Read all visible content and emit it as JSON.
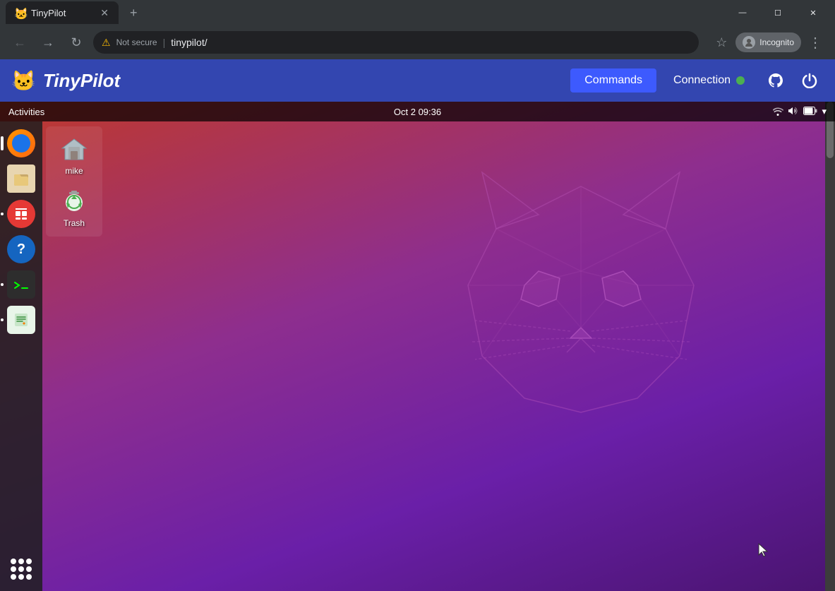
{
  "browser": {
    "tab": {
      "title": "TinyPilot",
      "favicon": "🐱"
    },
    "address": {
      "security_label": "Not secure",
      "url": "tinypilot/",
      "incognito_label": "Incognito"
    },
    "window_controls": {
      "minimize": "—",
      "maximize": "☐",
      "close": "✕"
    }
  },
  "tinypilot": {
    "logo_emoji": "🐱",
    "logo_text": "TinyPilot",
    "commands_label": "Commands",
    "connection_label": "Connection",
    "github_icon": "github",
    "power_icon": "power"
  },
  "ubuntu": {
    "topbar": {
      "activities": "Activities",
      "clock": "Oct 2  09:36",
      "wifi_icon": "wifi",
      "sound_icon": "sound",
      "battery_icon": "battery",
      "arrow_icon": "▾"
    },
    "dock": {
      "items": [
        {
          "name": "firefox",
          "label": "Firefox",
          "active": true
        },
        {
          "name": "files",
          "label": "Files",
          "active": false
        },
        {
          "name": "appstore",
          "label": "App Store",
          "active": false,
          "has_dot": true
        },
        {
          "name": "help",
          "label": "Help",
          "active": false
        },
        {
          "name": "terminal",
          "label": "Terminal",
          "active": false,
          "has_dot": true
        },
        {
          "name": "editor",
          "label": "Text Editor",
          "active": false,
          "has_dot": true
        }
      ]
    },
    "desktop_icons": [
      {
        "label": "mike",
        "icon": "home"
      },
      {
        "label": "Trash",
        "icon": "trash"
      }
    ]
  }
}
